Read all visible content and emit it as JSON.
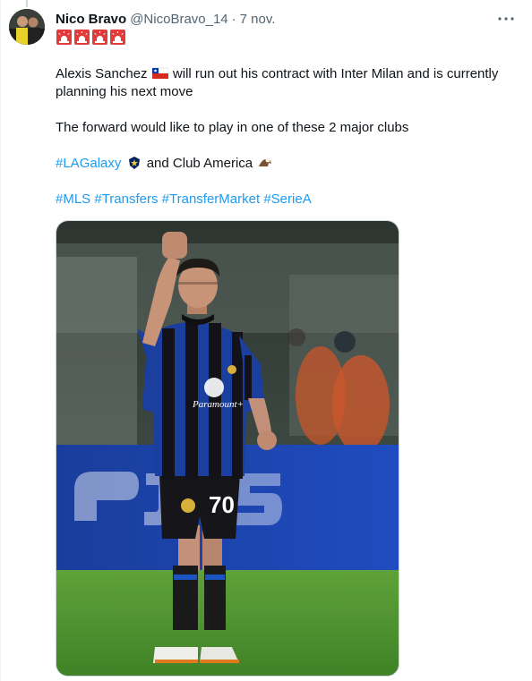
{
  "tweet": {
    "author_name": "Nico Bravo",
    "author_handle": "@NicoBravo_14",
    "separator": "·",
    "timestamp": "7 nov.",
    "alert_icons": [
      "rotating-light",
      "rotating-light",
      "rotating-light",
      "rotating-light"
    ],
    "line1_a": "Alexis Sanchez",
    "line1_b": "will run out his contract with Inter Milan and is currently",
    "line2": "planning his next move",
    "line3": "The forward would like to play in one of these 2 major clubs",
    "hashtag_lagalaxy": "#LAGalaxy",
    "line4_b": "and Club America",
    "hashtags": [
      "#MLS",
      "#Transfers",
      "#TransferMarket",
      "#SerieA"
    ],
    "emoji_flag": "chile-flag",
    "emoji_galaxy": "la-galaxy-crest",
    "emoji_eagle": "eagle",
    "media_jersey_number": "70",
    "media_sponsor": "Paramount+",
    "link_color": "#1d9bf0",
    "text_color": "#0f1419",
    "muted_color": "#536471"
  }
}
